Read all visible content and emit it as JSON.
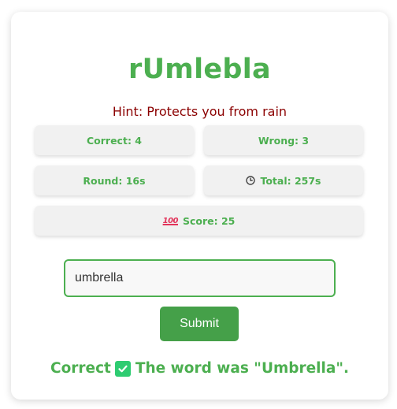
{
  "game": {
    "title": "rUmlebla",
    "hint": "Hint: Protects you from rain"
  },
  "stats": {
    "correct": "Correct: 4",
    "wrong": "Wrong: 3",
    "round": "Round: 16s",
    "total": "Total: 257s",
    "score": "Score: 25"
  },
  "icons": {
    "clock": "clock-icon",
    "hundred": "hundred-points-icon",
    "check": "check-mark-icon",
    "hundred_glyph": "100"
  },
  "form": {
    "input_value": "umbrella",
    "submit_label": "Submit"
  },
  "feedback": {
    "prefix": "Correct",
    "message": "The word was \"Umbrella\"."
  },
  "colors": {
    "accent": "#4caf50",
    "button": "#45a049",
    "hint": "#8b0000",
    "check": "#2ecc71"
  }
}
